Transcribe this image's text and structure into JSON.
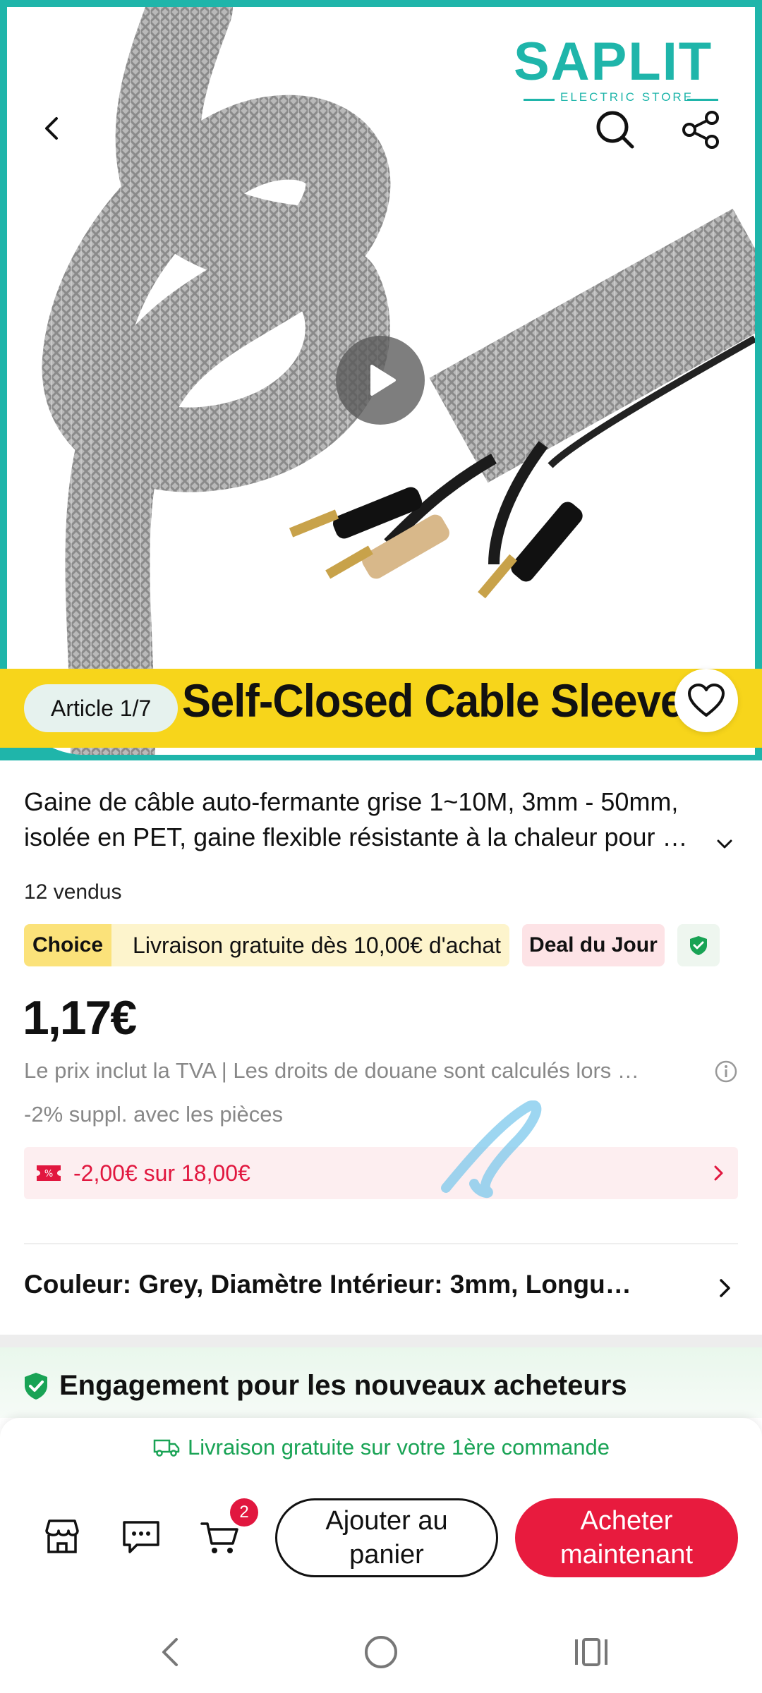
{
  "hero": {
    "logo_text": "SAPLIT",
    "logo_subtext": "ELECTRIC STORE",
    "banner_text": "Self-Closed Cable Sleeve",
    "article_counter": "Article 1/7",
    "icons": [
      "back-arrow-icon",
      "search-icon",
      "share-icon",
      "play-icon",
      "heart-icon"
    ]
  },
  "product": {
    "title_line1": "Gaine de câble auto-fermante grise 1~10M, 3mm - 50mm,",
    "title_line2": "isolée en PET, gaine flexible résistante à la chaleur pour …",
    "sold": "12 vendus",
    "choice_label": "Choice",
    "choice_text": "Livraison gratuite dès 10,00€ d'achat",
    "deal_label": "Deal du Jour",
    "price": "1,17€",
    "tax_note": "Le prix inclut la TVA | Les droits de douane sont calculés lors …",
    "extra_discount": "-2% suppl. avec les pièces",
    "coupon_text": "-2,00€ sur 18,00€",
    "variant": "Couleur: Grey, Diamètre Intérieur: 3mm, Longu…"
  },
  "engagement": {
    "title": "Engagement pour les nouveaux acheteurs"
  },
  "action_bar": {
    "shipping_note": "Livraison gratuite sur votre 1ère commande",
    "cart_count": "2",
    "add_to_cart_line1": "Ajouter au",
    "add_to_cart_line2": "panier",
    "buy_now_line1": "Acheter",
    "buy_now_line2": "maintenant"
  },
  "colors": {
    "brand_teal": "#1fb5aa",
    "banner_yellow": "#f7d51b",
    "accent_red": "#e81b3e",
    "success_green": "#19a355"
  }
}
